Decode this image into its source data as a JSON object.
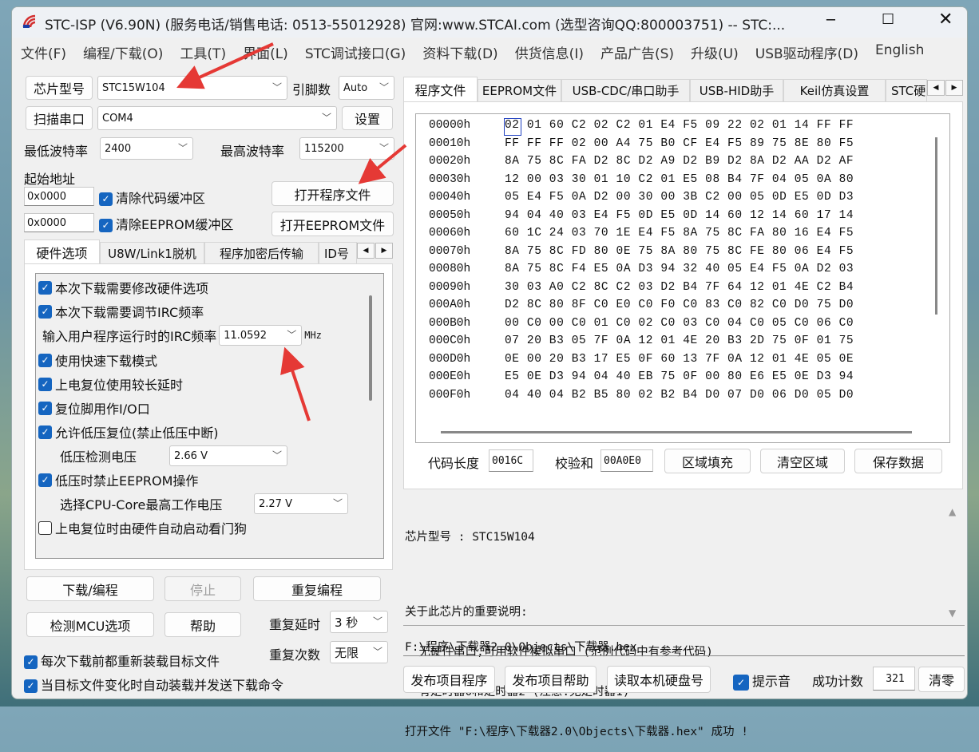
{
  "window": {
    "title": "STC-ISP (V6.90N) (服务电话/销售电话: 0513-55012928) 官网:www.STCAI.com  (选型咨询QQ:800003751) -- STC:..."
  },
  "menu": [
    "文件(F)",
    "编程/下载(O)",
    "工具(T)",
    "界面(L)",
    "STC调试接口(G)",
    "资料下载(D)",
    "供货信息(I)",
    "产品广告(S)",
    "升级(U)",
    "USB驱动程序(D)",
    "English"
  ],
  "left": {
    "chip_btn": "芯片型号",
    "chip_value": "STC15W104",
    "pins_label": "引脚数",
    "pins_value": "Auto",
    "scan_btn": "扫描串口",
    "port_value": "COM4",
    "settings_btn": "设置",
    "min_baud_label": "最低波特率",
    "min_baud": "2400",
    "max_baud_label": "最高波特率",
    "max_baud": "115200",
    "start_addr_label": "起始地址",
    "addr1": "0x0000",
    "clear_code": "清除代码缓冲区",
    "open_prog": "打开程序文件",
    "addr2": "0x0000",
    "clear_eeprom": "清除EEPROM缓冲区",
    "open_eeprom": "打开EEPROM文件",
    "tabs": [
      "硬件选项",
      "U8W/Link1脱机",
      "程序加密后传输",
      "ID号"
    ],
    "options": {
      "o1": "本次下载需要修改硬件选项",
      "o2": "本次下载需要调节IRC频率",
      "irc_label": "输入用户程序运行时的IRC频率",
      "irc_value": "11.0592",
      "irc_unit": "MHz",
      "o3": "使用快速下载模式",
      "o4": "上电复位使用较长延时",
      "o5": "复位脚用作I/O口",
      "o6": "允许低压复位(禁止低压中断)",
      "lv_label": "低压检测电压",
      "lv_value": "2.66 V",
      "o7": "低压时禁止EEPROM操作",
      "cpu_label": "选择CPU-Core最高工作电压",
      "cpu_value": "2.27 V",
      "o8": "上电复位时由硬件自动启动看门狗"
    },
    "download_btn": "下载/编程",
    "stop_btn": "停止",
    "repeat_btn": "重复编程",
    "detect_btn": "检测MCU选项",
    "help_btn": "帮助",
    "delay_label": "重复延时",
    "delay_value": "3 秒",
    "count_label": "重复次数",
    "count_value": "无限",
    "reload": "每次下载前都重新装载目标文件",
    "auto_send": "当目标文件变化时自动装载并发送下载命令"
  },
  "right": {
    "tabs": [
      "程序文件",
      "EEPROM文件",
      "USB-CDC/串口助手",
      "USB-HID助手",
      "Keil仿真设置",
      "STC硬"
    ],
    "hex": [
      [
        "00000h",
        "02 01 60 C2 02 C2 01 E4 F5 09 22 02 01 14 FF FF"
      ],
      [
        "00010h",
        "FF FF FF 02 00 A4 75 B0 CF E4 F5 89 75 8E 80 F5"
      ],
      [
        "00020h",
        "8A 75 8C FA D2 8C D2 A9 D2 B9 D2 8A D2 AA D2 AF"
      ],
      [
        "00030h",
        "12 00 03 30 01 10 C2 01 E5 08 B4 7F 04 05 0A 80"
      ],
      [
        "00040h",
        "05 E4 F5 0A D2 00 30 00 3B C2 00 05 0D E5 0D D3"
      ],
      [
        "00050h",
        "94 04 40 03 E4 F5 0D E5 0D 14 60 12 14 60 17 14"
      ],
      [
        "00060h",
        "60 1C 24 03 70 1E E4 F5 8A 75 8C FA 80 16 E4 F5"
      ],
      [
        "00070h",
        "8A 75 8C FD 80 0E 75 8A 80 75 8C FE 80 06 E4 F5"
      ],
      [
        "00080h",
        "8A 75 8C F4 E5 0A D3 94 32 40 05 E4 F5 0A D2 03"
      ],
      [
        "00090h",
        "30 03 A0 C2 8C C2 03 D2 B4 7F 64 12 01 4E C2 B4"
      ],
      [
        "000A0h",
        "D2 8C 80 8F C0 E0 C0 F0 C0 83 C0 82 C0 D0 75 D0"
      ],
      [
        "000B0h",
        "00 C0 00 C0 01 C0 02 C0 03 C0 04 C0 05 C0 06 C0"
      ],
      [
        "000C0h",
        "07 20 B3 05 7F 0A 12 01 4E 20 B3 2D 75 0F 01 75"
      ],
      [
        "000D0h",
        "0E 00 20 B3 17 E5 0F 60 13 7F 0A 12 01 4E 05 0E"
      ],
      [
        "000E0h",
        "E5 0E D3 94 04 40 EB 75 0F 00 80 E6 E5 0E D3 94"
      ],
      [
        "000F0h",
        "04 40 04 B2 B5 80 02 B2 B4 D0 07 D0 06 D0 05 D0"
      ]
    ],
    "code_len_label": "代码长度",
    "code_len": "0016C",
    "checksum_label": "校验和",
    "checksum": "00A0E0",
    "fill_btn": "区域填充",
    "clear_btn": "清空区域",
    "save_btn": "保存数据",
    "log": [
      "芯片型号 : STC15W104",
      "",
      "关于此芯片的重要说明:",
      "  无硬件串口,可用软件模拟串口 (范例代码中有参考代码)",
      "  有定时器0和定时器2 (注意:无定时器1)",
      "打开文件 \"F:\\程序\\下载器2.0\\Objects\\下载器.hex\" 成功 !"
    ],
    "path": "F:\\程序\\下载器2.0\\Objects\\下载器.hex",
    "publish_prog": "发布项目程序",
    "publish_help": "发布项目帮助",
    "read_disk": "读取本机硬盘号",
    "beep": "提示音",
    "success_label": "成功计数",
    "success_count": "321",
    "reset_btn": "清零"
  },
  "colors": {
    "accent": "#1565c0",
    "annotation": "#e53935"
  }
}
